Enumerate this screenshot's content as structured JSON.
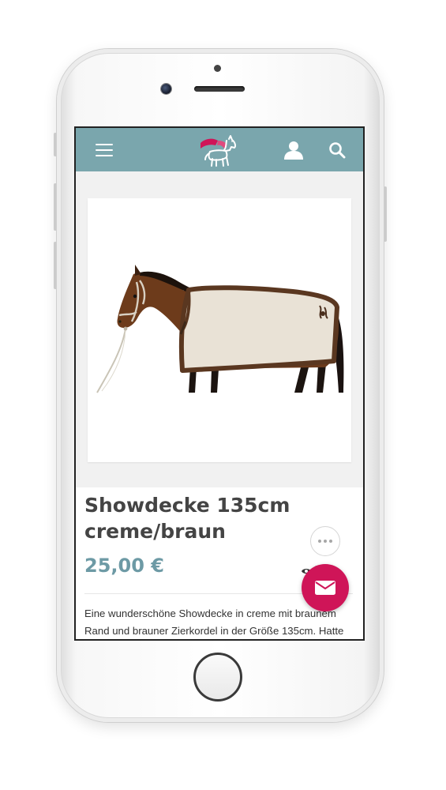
{
  "product": {
    "title": "Showdecke 135cm creme/braun",
    "price": "25,00 €",
    "views": "1",
    "description": "Eine wunderschöne Showdecke in creme mit braunem Rand und brauner Zierkordel in der Größe 135cm. Hatte"
  },
  "nav": {
    "menu_icon": "hamburger-menu-icon",
    "logo_icon": "horse-logo-icon",
    "account_icon": "user-icon",
    "search_icon": "search-icon"
  },
  "actions": {
    "more_icon": "more-dots-icon",
    "contact_icon": "mail-icon"
  },
  "colors": {
    "navbar": "#7aa6ad",
    "price": "#6d9aa5",
    "title": "#444444",
    "mail_button": "#cf1558",
    "logo_cape": "#cf1558"
  }
}
